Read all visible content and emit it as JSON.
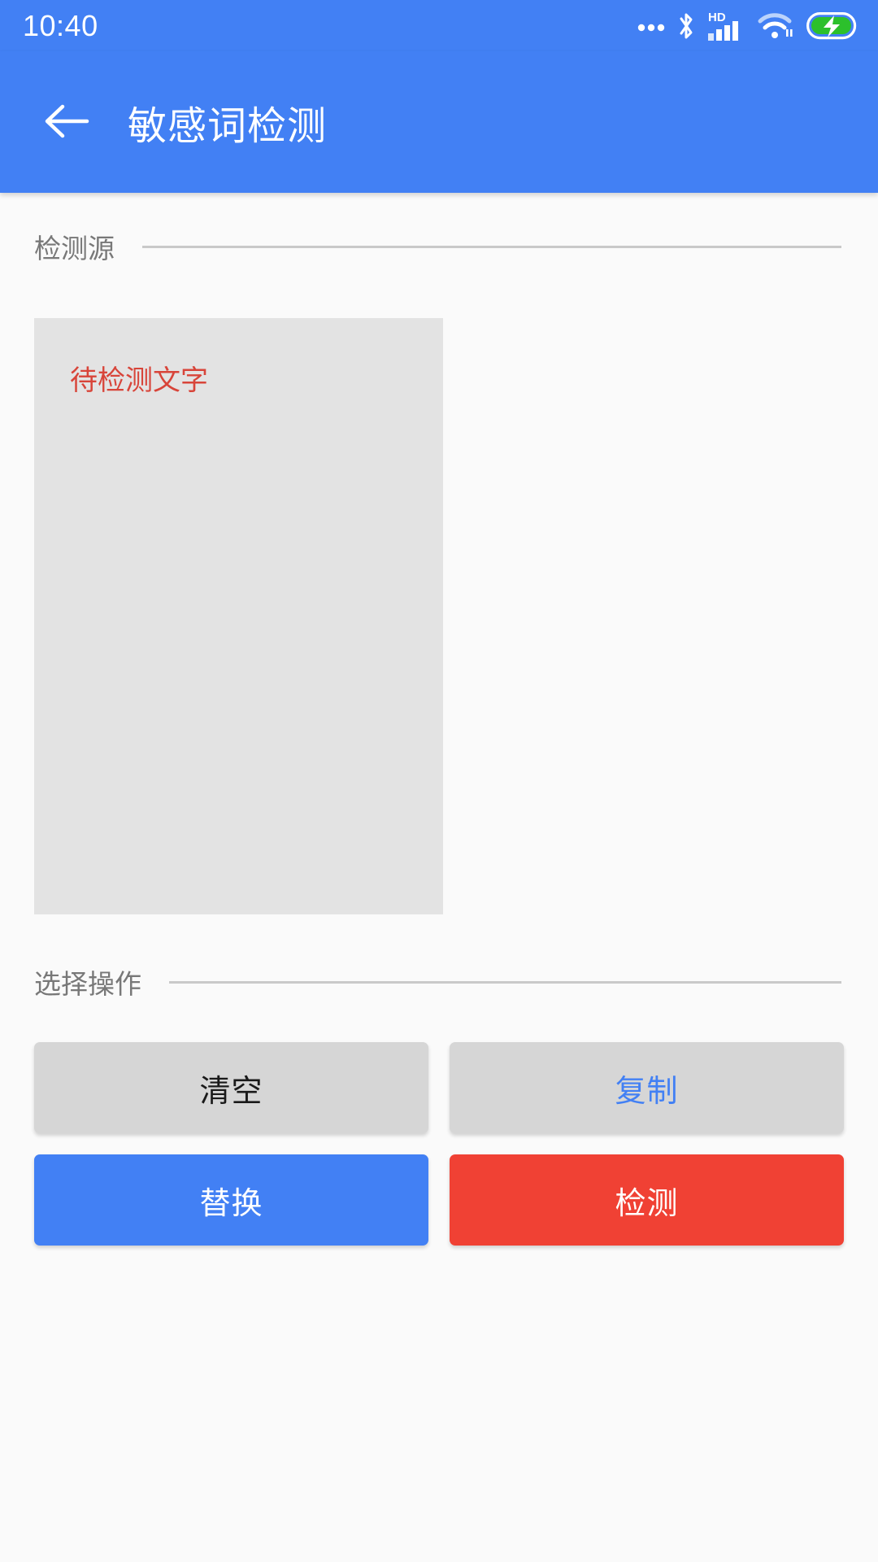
{
  "colors": {
    "brand_blue": "#4280F4",
    "danger_red": "#F04134",
    "placeholder_red": "#D8453A",
    "button_gray": "#D6D6D6",
    "field_gray": "#E3E3E3",
    "page_bg": "#FAFAFA",
    "rule_gray": "#C9C9C9",
    "label_gray": "#787878"
  },
  "status_bar": {
    "time": "10:40",
    "icons": [
      {
        "name": "more-dots-icon",
        "glyph": "•••"
      },
      {
        "name": "bluetooth-icon",
        "glyph": "bluetooth"
      },
      {
        "name": "hd-signal-icon",
        "glyph": "HD",
        "label": "HD"
      },
      {
        "name": "wifi-icon",
        "glyph": "wifi"
      },
      {
        "name": "battery-charging-icon",
        "glyph": "battery-bolt"
      }
    ]
  },
  "app_bar": {
    "back_icon": "arrow-left-icon",
    "title": "敏感词检测"
  },
  "sections": {
    "source": {
      "label": "检测源",
      "textarea_value": "",
      "textarea_placeholder": "待检测文字"
    },
    "operations": {
      "label": "选择操作",
      "buttons": [
        {
          "label": "清空",
          "style": "gray-dark"
        },
        {
          "label": "复制",
          "style": "gray-link"
        },
        {
          "label": "替换",
          "style": "blue"
        },
        {
          "label": "检测",
          "style": "red"
        }
      ]
    }
  }
}
